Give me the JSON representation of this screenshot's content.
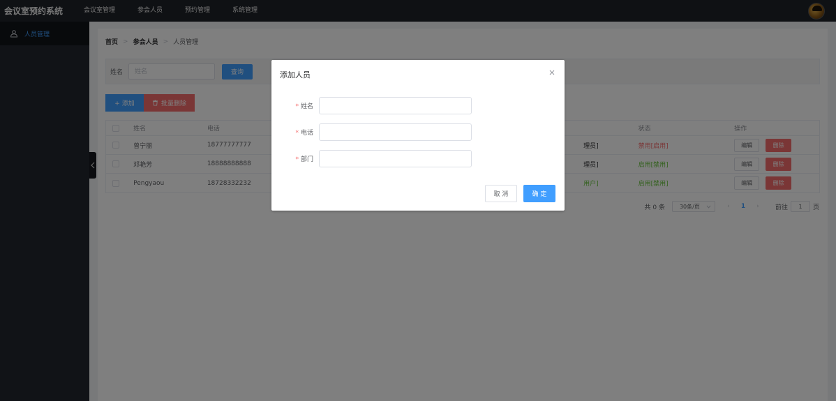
{
  "app": {
    "title": "会议室预约系统"
  },
  "topnav": [
    "会议室管理",
    "参会人员",
    "预约管理",
    "系统管理"
  ],
  "sidebar": {
    "items": [
      {
        "label": "人员管理",
        "icon": "user-group-icon"
      }
    ]
  },
  "breadcrumb": [
    "首页",
    "参会人员",
    "人员管理"
  ],
  "search": {
    "label": "姓名",
    "placeholder": "姓名",
    "button": "查询"
  },
  "toolbar": {
    "add_label": "+ 添加",
    "batch_delete_label": "批量删除"
  },
  "table": {
    "columns": {
      "name": "姓名",
      "phone": "电话",
      "status": "状态",
      "ops": "操作"
    },
    "rows": [
      {
        "name": "曾宁丽",
        "phone": "18777777777",
        "role_fragment": "理员]",
        "status": "禁用[启用]",
        "status_type": "disabled"
      },
      {
        "name": "邓艳芳",
        "phone": "18888888888",
        "role_fragment": "理员]",
        "status": "启用[禁用]",
        "status_type": "enabled"
      },
      {
        "name": "Pengyaou",
        "phone": "18728332232",
        "role_fragment": "用户]",
        "status": "启用[禁用]",
        "status_type": "enabled"
      }
    ],
    "edit_label": "编辑",
    "delete_label": "删除"
  },
  "pagination": {
    "total_text": "共 0 条",
    "page_size": "30条/页",
    "current_page": "1",
    "goto_label": "前往",
    "goto_value": "1",
    "page_unit": "页"
  },
  "dialog": {
    "title": "添加人员",
    "fields": [
      {
        "label": "姓名",
        "value": ""
      },
      {
        "label": "电话",
        "value": ""
      },
      {
        "label": "部门",
        "value": ""
      }
    ],
    "cancel_label": "取 消",
    "confirm_label": "确 定"
  },
  "colors": {
    "primary": "#409eff",
    "danger": "#f56c6c",
    "success": "#67c23a",
    "topbar": "#1f2329",
    "sidebar": "#23272e"
  }
}
